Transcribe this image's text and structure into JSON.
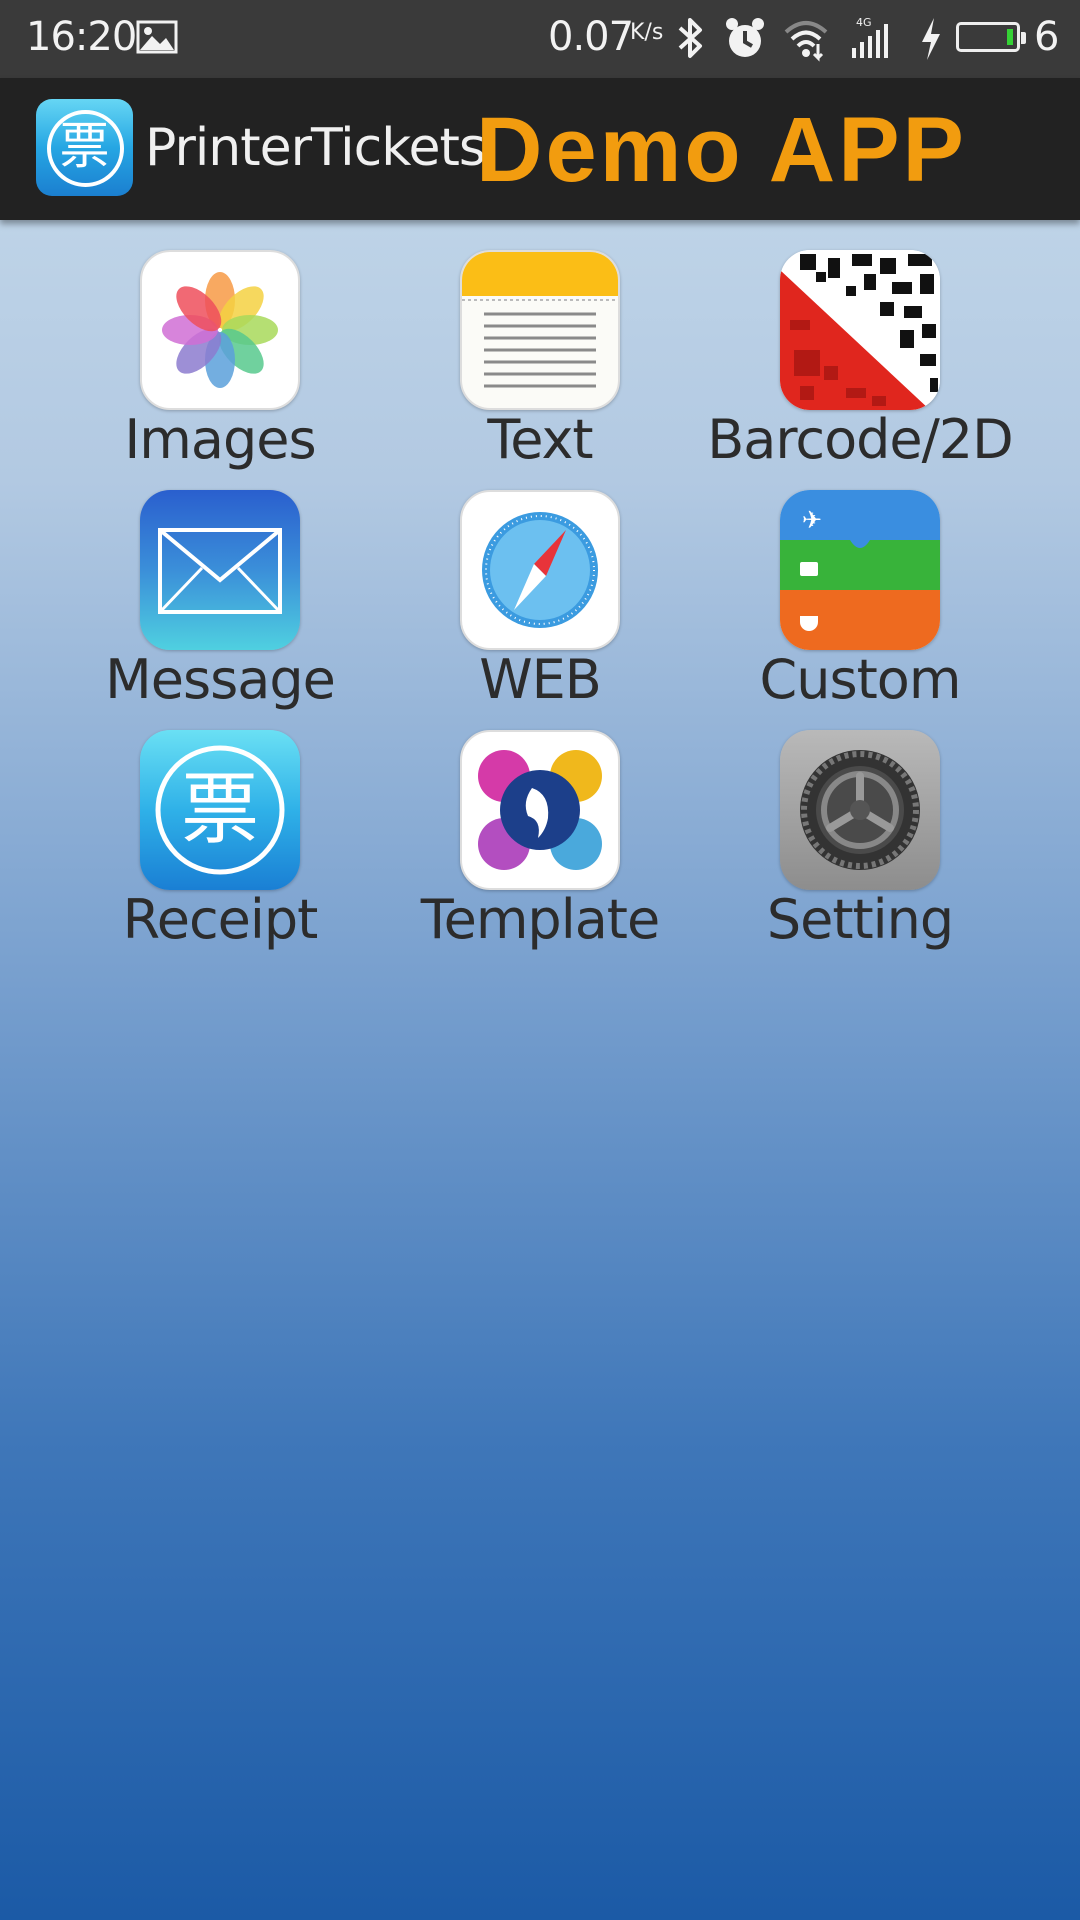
{
  "status_bar": {
    "time": "16:20",
    "net_speed": "0.07",
    "net_speed_unit": "K/s",
    "battery_level": "6",
    "network_type": "4G",
    "icons": [
      "image-icon",
      "bluetooth-icon",
      "alarm-icon",
      "wifi-icon",
      "signal-icon",
      "charging-icon",
      "battery-icon"
    ]
  },
  "app_bar": {
    "logo_char": "票",
    "app_name": "PrinterTickets",
    "title": "Demo APP",
    "title_color": "#f29c0f"
  },
  "tiles": [
    {
      "label": "Images",
      "icon": "photos-icon"
    },
    {
      "label": "Text",
      "icon": "notes-icon"
    },
    {
      "label": "Barcode/2D",
      "icon": "qr-code-icon"
    },
    {
      "label": "Message",
      "icon": "mail-icon"
    },
    {
      "label": "WEB",
      "icon": "compass-icon"
    },
    {
      "label": "Custom",
      "icon": "wallet-icon"
    },
    {
      "label": "Receipt",
      "icon": "ticket-icon"
    },
    {
      "label": "Template",
      "icon": "palette-icon"
    },
    {
      "label": "Setting",
      "icon": "settings-gear-icon"
    }
  ],
  "receipt_char": "票"
}
